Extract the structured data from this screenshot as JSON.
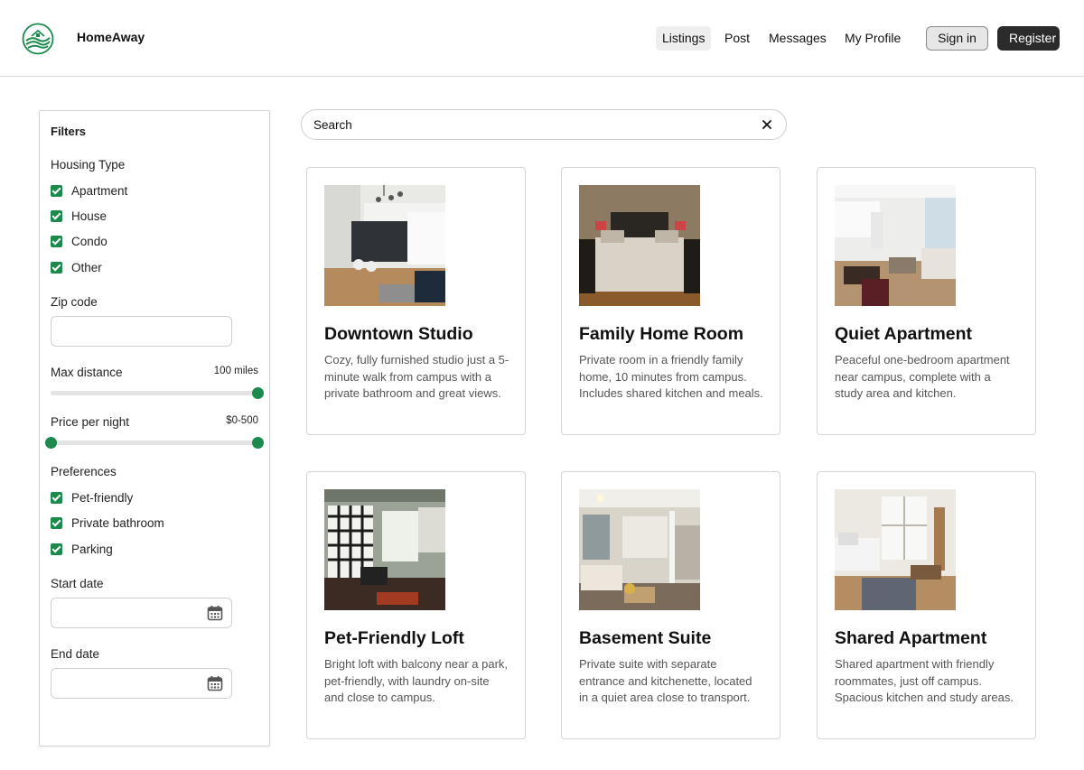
{
  "header": {
    "brand": "HomeAway",
    "logo_icon": "house-hills-logo-icon",
    "nav": [
      {
        "label": "Listings",
        "active": true
      },
      {
        "label": "Post",
        "active": false
      },
      {
        "label": "Messages",
        "active": false
      },
      {
        "label": "My Profile",
        "active": false
      }
    ],
    "signin_label": "Sign in",
    "register_label": "Register"
  },
  "filters": {
    "title": "Filters",
    "housing_type": {
      "label": "Housing Type",
      "options": [
        {
          "label": "Apartment",
          "checked": true
        },
        {
          "label": "House",
          "checked": true
        },
        {
          "label": "Condo",
          "checked": true
        },
        {
          "label": "Other",
          "checked": true
        }
      ]
    },
    "zip": {
      "label": "Zip code",
      "value": ""
    },
    "max_distance": {
      "label": "Max distance",
      "value_text": "100 miles",
      "value": 100,
      "max": 100
    },
    "price": {
      "label": "Price per night",
      "value_text": "$0-500",
      "min": 0,
      "max": 500
    },
    "preferences": {
      "label": "Preferences",
      "options": [
        {
          "label": "Pet-friendly",
          "checked": true
        },
        {
          "label": "Private bathroom",
          "checked": true
        },
        {
          "label": "Parking",
          "checked": true
        }
      ]
    },
    "start_date": {
      "label": "Start date",
      "value": ""
    },
    "end_date": {
      "label": "End date",
      "value": ""
    }
  },
  "search": {
    "placeholder": "Search",
    "value": ""
  },
  "listings": [
    {
      "title": "Downtown Studio",
      "description": "Cozy, fully furnished studio just a 5-minute walk from campus with a private bathroom and great views."
    },
    {
      "title": "Family Home Room",
      "description": "Private room in a friendly family home, 10 minutes from campus. Includes shared kitchen and meals."
    },
    {
      "title": "Quiet Apartment",
      "description": "Peaceful one-bedroom apartment near campus, complete with a study area and kitchen."
    },
    {
      "title": "Pet-Friendly Loft",
      "description": "Bright loft with balcony near a park, pet-friendly, with laundry on-site and close to campus."
    },
    {
      "title": "Basement Suite",
      "description": "Private suite with separate entrance and kitchenette, located in a quiet area close to transport."
    },
    {
      "title": "Shared Apartment",
      "description": "Shared apartment with friendly roommates, just off campus. Spacious kitchen and study areas."
    }
  ],
  "colors": {
    "accent": "#1b8a4c",
    "dark_button": "#2b2b2b"
  }
}
